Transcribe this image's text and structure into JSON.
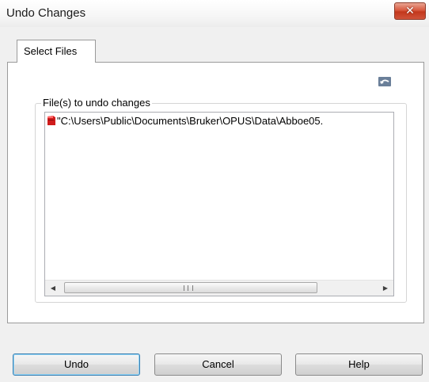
{
  "window": {
    "title": "Undo Changes",
    "close_glyph": "✕"
  },
  "tabs": [
    {
      "label": "Select Files",
      "selected": true
    }
  ],
  "toolbar": {
    "undo_icon": "undo-arrow-icon"
  },
  "group": {
    "label": "File(s) to undo changes"
  },
  "files": [
    {
      "path": "\"C:\\Users\\Public\\Documents\\Bruker\\OPUS\\Data\\Abboe05.",
      "icon": "red-file-icon"
    }
  ],
  "scrollbar": {
    "left_arrow": "◀",
    "right_arrow": "▶"
  },
  "buttons": {
    "undo": "Undo",
    "cancel": "Cancel",
    "help": "Help"
  },
  "colors": {
    "close_button": "#c3381c",
    "file_icon": "#d01c1c",
    "default_button_border": "#3c7fb1"
  }
}
